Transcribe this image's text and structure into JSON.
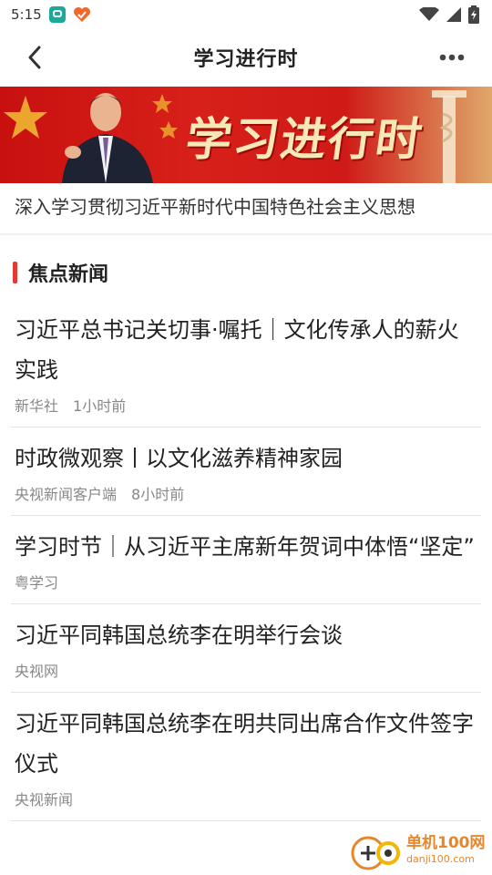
{
  "status_bar": {
    "time": "5:15"
  },
  "header": {
    "title": "学习进行时"
  },
  "banner": {
    "title": "学习进行时"
  },
  "subtitle": "深入学习贯彻习近平新时代中国特色社会主义思想",
  "section": {
    "title": "焦点新闻"
  },
  "news": [
    {
      "title": "习近平总书记关切事·嘱托｜文化传承人的薪火实践",
      "source": "新华社",
      "time": "1小时前"
    },
    {
      "title": "时政微观察丨以文化滋养精神家园",
      "source": "央视新闻客户端",
      "time": "8小时前"
    },
    {
      "title": "学习时节｜从习近平主席新年贺词中体悟“坚定”",
      "source": "粤学习",
      "time": ""
    },
    {
      "title": "习近平同韩国总统李在明举行会谈",
      "source": "央视网",
      "time": ""
    },
    {
      "title": "习近平同韩国总统李在明共同出席合作文件签字仪式",
      "source": "央视新闻",
      "time": ""
    }
  ],
  "watermark": {
    "main": "单机100网",
    "sub": "danji100.com"
  },
  "colors": {
    "accent": "#e53935",
    "banner_red": "#d8201a",
    "watermark": "#e8862c"
  },
  "icons": [
    "back-arrow-icon",
    "more-dots-icon",
    "wifi-icon",
    "signal-icon",
    "battery-icon"
  ]
}
